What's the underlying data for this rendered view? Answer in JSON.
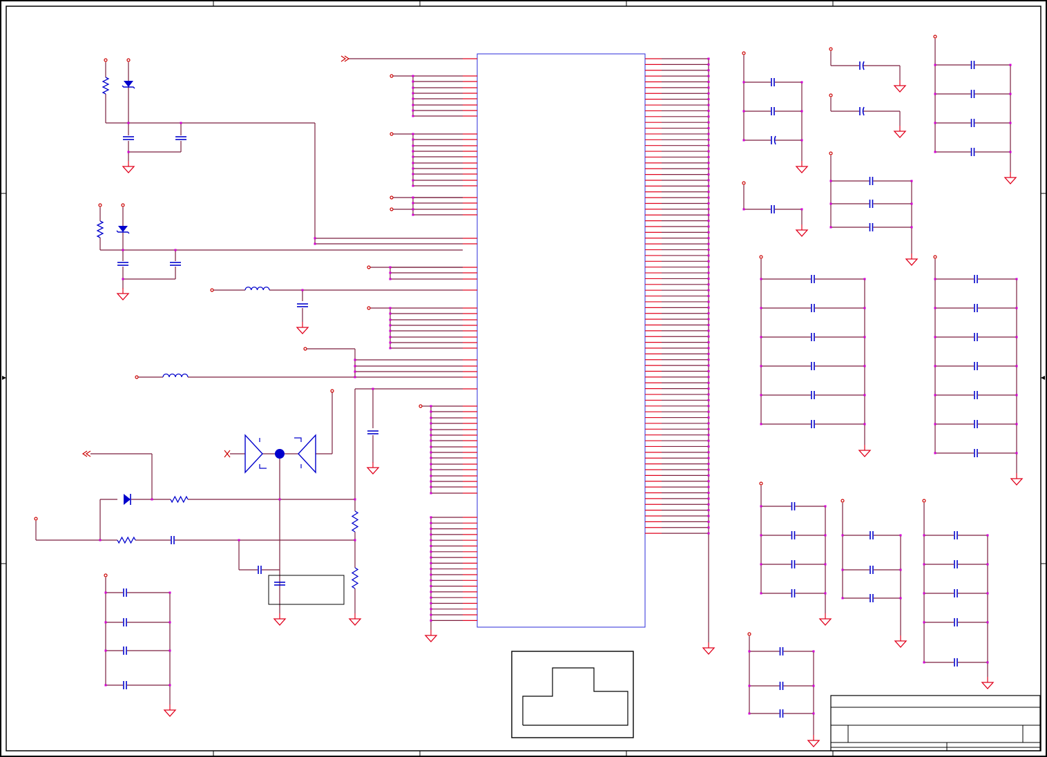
{
  "diagram": {
    "type": "electronic schematic sheet",
    "colors": {
      "background": "#ffffff",
      "border": "#000000",
      "wire": "#7a1f3d",
      "pin": "#e0001b",
      "junction": "#d400d4",
      "component": "#0000cc",
      "ic_outline": "#2a2ad8",
      "net_terminal": "#cc0000",
      "ground": "#e0001b"
    },
    "symbols": [
      "resistor",
      "capacitor",
      "polarized-capacitor",
      "inductor",
      "zener-diode",
      "diode",
      "ground",
      "net-port",
      "crystal",
      "no-connect",
      "ic-block",
      "title-block"
    ],
    "ic_block": {
      "left_pin_count": 60,
      "right_pin_count": 83
    },
    "text_labels": []
  }
}
